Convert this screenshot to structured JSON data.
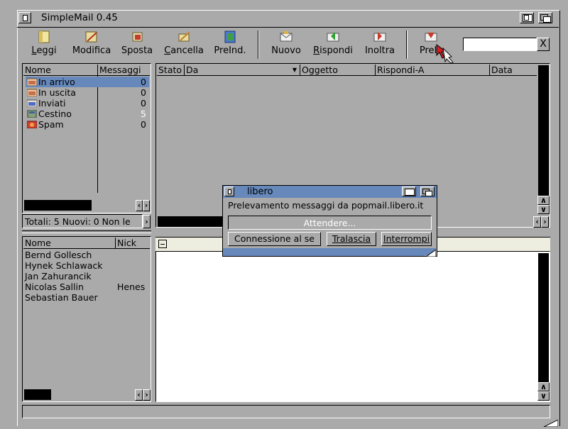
{
  "window": {
    "title": "SimpleMail 0.45"
  },
  "toolbar": {
    "buttons": [
      {
        "label": "Leggi",
        "underline": "L",
        "rest": "eggi",
        "icon": "read-icon"
      },
      {
        "label": "Modifica",
        "underline": "",
        "rest": "",
        "icon": "edit-icon"
      },
      {
        "label": "Sposta",
        "underline": "",
        "rest": "",
        "icon": "move-icon"
      },
      {
        "label": "Cancella",
        "underline": "C",
        "rest": "ancella",
        "icon": "delete-icon"
      },
      {
        "label": "PreInd.",
        "underline": "",
        "rest": "",
        "icon": "address-book-icon"
      },
      {
        "label": "Nuovo",
        "underline": "",
        "rest": "",
        "icon": "new-mail-icon"
      },
      {
        "label": "Rispondi",
        "underline": "R",
        "rest": "ispondi",
        "icon": "reply-icon"
      },
      {
        "label": "Inoltra",
        "underline": "",
        "rest": "",
        "icon": "forward-icon"
      },
      {
        "label": "Prele",
        "underline": "",
        "rest": "",
        "icon": "fetch-icon"
      }
    ],
    "search_value": "",
    "clear_label": "X"
  },
  "folders": {
    "headers": {
      "name": "Nome",
      "messages": "Messaggi"
    },
    "items": [
      {
        "name": "In arrivo",
        "count": "0",
        "color": "#c86c4c"
      },
      {
        "name": "In uscita",
        "count": "0",
        "color": "#c86c4c"
      },
      {
        "name": "Inviati",
        "count": "0",
        "color": "#4c6cc8"
      },
      {
        "name": "Cestino",
        "count": "5",
        "color": "#6a8a5a"
      },
      {
        "name": "Spam",
        "count": "0",
        "color": "#c83a2a"
      }
    ],
    "status": "Totali: 5 Nuovi: 0 Non le"
  },
  "messages": {
    "headers": {
      "status": "Stato",
      "from": "Da",
      "subject": "Oggetto",
      "reply_to": "Rispondi-A",
      "date": "Data"
    }
  },
  "addressbook": {
    "headers": {
      "name": "Nome",
      "nick": "Nick"
    },
    "items": [
      {
        "name": "Bernd Gollesch",
        "nick": ""
      },
      {
        "name": "Hynek Schlawack",
        "nick": ""
      },
      {
        "name": "Jan Zahurancik",
        "nick": ""
      },
      {
        "name": "Nicolas Sallin",
        "nick": "Henes"
      },
      {
        "name": "Sebastian Bauer",
        "nick": ""
      }
    ]
  },
  "dialog": {
    "title": "libero",
    "message": "Prelevamento messaggi da popmail.libero.it",
    "progress_text": "Attendere...",
    "buttons": {
      "status": "Connessione al se",
      "skip": "Tralascia",
      "abort": "Interrompi"
    }
  },
  "colors": {
    "selected": "#6688bb",
    "titlebar_active": "#6688bb",
    "background": "#aaaaaa"
  }
}
